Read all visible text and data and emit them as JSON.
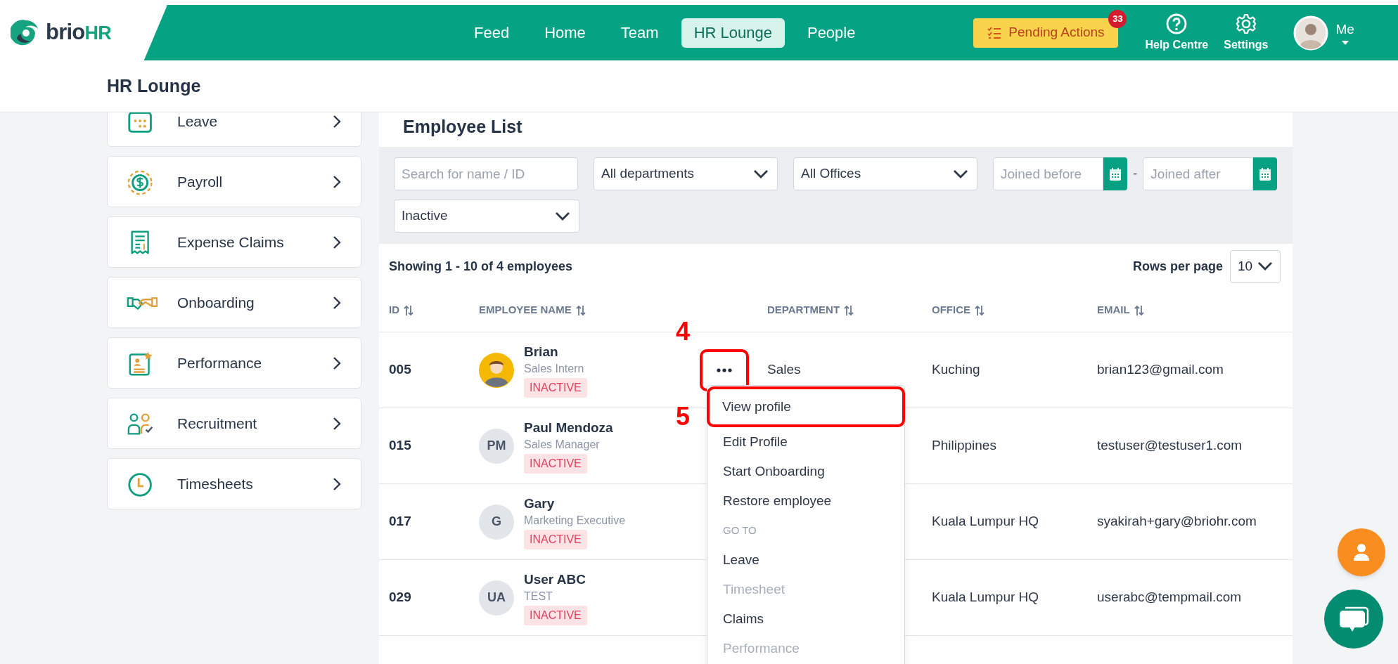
{
  "header": {
    "logo": {
      "text": "brio",
      "accent": "HR"
    },
    "nav": [
      {
        "label": "Feed",
        "selected": false
      },
      {
        "label": "Home",
        "selected": false
      },
      {
        "label": "Team",
        "selected": false
      },
      {
        "label": "HR Lounge",
        "selected": true
      },
      {
        "label": "People",
        "selected": false
      }
    ],
    "pending_actions": {
      "label": "Pending Actions",
      "badge": "33"
    },
    "links": [
      {
        "kind": "help",
        "label": "Help Centre"
      },
      {
        "kind": "settings",
        "label": "Settings"
      }
    ],
    "user": {
      "label": "Me"
    }
  },
  "page_title": "HR Lounge",
  "sidebar": {
    "items": [
      {
        "kind": "leave",
        "label": "Leave"
      },
      {
        "kind": "payroll",
        "label": "Payroll"
      },
      {
        "kind": "expense",
        "label": "Expense Claims"
      },
      {
        "kind": "onboarding",
        "label": "Onboarding"
      },
      {
        "kind": "performance",
        "label": "Performance"
      },
      {
        "kind": "recruitment",
        "label": "Recruitment"
      },
      {
        "kind": "timesheets",
        "label": "Timesheets"
      }
    ]
  },
  "employee_list": {
    "title": "Employee List",
    "filters": {
      "search": {
        "placeholder": "Search for name / ID"
      },
      "department": {
        "value": "All departments"
      },
      "office": {
        "value": "All Offices"
      },
      "joined_before": {
        "placeholder": "Joined before"
      },
      "separator": "-",
      "joined_after": {
        "placeholder": "Joined after"
      },
      "status": {
        "value": "Inactive"
      }
    },
    "summary": "Showing 1 - 10 of 4 employees",
    "rows_per_page": {
      "label": "Rows per page",
      "value": "10"
    },
    "columns": [
      {
        "label": "ID"
      },
      {
        "label": "EMPLOYEE NAME"
      },
      {
        "label": "DEPARTMENT"
      },
      {
        "label": "OFFICE"
      },
      {
        "label": "EMAIL"
      }
    ],
    "rows": [
      {
        "id": "005",
        "name": "Brian",
        "title": "Sales Intern",
        "status": "INACTIVE",
        "action_button": {
          "highlighted": true
        },
        "department": "Sales",
        "office": "Kuching",
        "email": "brian123@gmail.com"
      },
      {
        "id": "015",
        "name": "Paul Mendoza",
        "title": "Sales Manager",
        "status": "INACTIVE",
        "avatar": {
          "kind": "initials",
          "initials": "PM"
        },
        "office": "Philippines",
        "email": "testuser@testuser1.com"
      },
      {
        "id": "017",
        "name": "Gary",
        "title": "Marketing Executive",
        "status": "INACTIVE",
        "avatar": {
          "kind": "initials",
          "initials": "G"
        },
        "office": "Kuala Lumpur HQ",
        "email": "syakirah+gary@briohr.com"
      },
      {
        "id": "029",
        "name": "User ABC",
        "title": "TEST",
        "status": "INACTIVE",
        "avatar": {
          "kind": "initials",
          "initials": "UA"
        },
        "office": "Kuala Lumpur HQ",
        "email": "userabc@tempmail.com"
      }
    ]
  },
  "row_menu": {
    "items": [
      {
        "kind": "item",
        "label": "View profile",
        "disabled": false,
        "highlighted": true
      },
      {
        "kind": "item",
        "label": "Edit Profile",
        "disabled": false,
        "highlighted": false
      },
      {
        "kind": "item",
        "label": "Start Onboarding",
        "disabled": false,
        "highlighted": false
      },
      {
        "kind": "item",
        "label": "Restore employee",
        "disabled": false,
        "highlighted": false
      },
      {
        "kind": "heading",
        "label": "GO TO"
      },
      {
        "kind": "item",
        "label": "Leave",
        "disabled": false,
        "highlighted": false
      },
      {
        "kind": "item",
        "label": "Timesheet",
        "disabled": true,
        "highlighted": false
      },
      {
        "kind": "item",
        "label": "Claims",
        "disabled": false,
        "highlighted": false
      },
      {
        "kind": "item",
        "label": "Performance",
        "disabled": true,
        "highlighted": false
      }
    ]
  },
  "annotations": [
    {
      "label": "4"
    },
    {
      "label": "5"
    }
  ]
}
